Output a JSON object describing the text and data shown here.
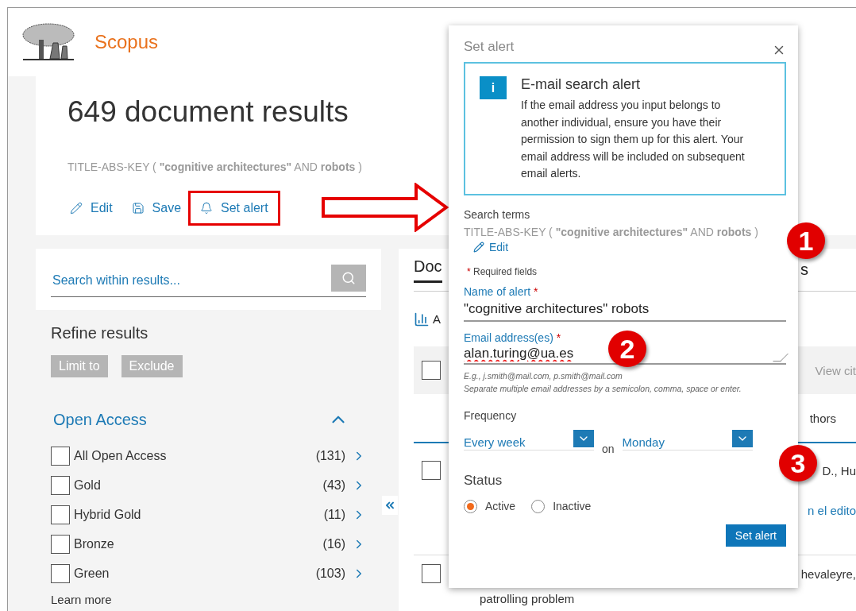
{
  "header": {
    "brand": "Scopus"
  },
  "results": {
    "title": "649 document results",
    "query": "TITLE-ABS-KEY ( **\"cognitive architectures\"**  AND  **robots** )",
    "actions": [
      {
        "kind": "edit",
        "label": "Edit",
        "highlighted": false
      },
      {
        "kind": "save",
        "label": "Save",
        "highlighted": false
      },
      {
        "kind": "alert",
        "label": "Set alert",
        "highlighted": true
      }
    ]
  },
  "search_within": {
    "placeholder": "Search within results..."
  },
  "refine": {
    "title": "Refine results",
    "buttons": [
      "Limit to",
      "Exclude"
    ]
  },
  "open_access": {
    "title": "Open Access",
    "expanded": true,
    "items": [
      {
        "label": "All Open Access",
        "count": "(131)",
        "checked": false
      },
      {
        "label": "Gold",
        "count": "(43)",
        "checked": false
      },
      {
        "label": "Hybrid Gold",
        "count": "(11)",
        "checked": false
      },
      {
        "label": "Bronze",
        "count": "(16)",
        "checked": false
      },
      {
        "label": "Green",
        "count": "(103)",
        "checked": false
      }
    ],
    "learn_more": "Learn more"
  },
  "results_panel": {
    "tab_left": "Doc",
    "tab_right": "s",
    "analyze": "A",
    "select_all_checked": false,
    "view_citations": "View cit",
    "authors": "thors",
    "rows": [
      {
        "kind": "author",
        "text": "D., Hu",
        "checked": false
      },
      {
        "kind": "link",
        "text": "n el edito"
      },
      {
        "kind": "author",
        "text": "hevaleyre,",
        "checked": false
      }
    ],
    "cut_title": "patrolling problem"
  },
  "modal": {
    "title": "Set alert",
    "info": {
      "icon": "i",
      "title": "E-mail search alert",
      "body": "If the email address you input belongs to another individual, ensure you have their permission to sign them up for this alert. Your email address will be included on subsequent email alerts."
    },
    "search_terms_label": "Search terms",
    "query": "TITLE-ABS-KEY ( **\"cognitive architectures\"** AND **robots** )",
    "edit": "Edit",
    "required_mark": "*",
    "required_note": "Required fields",
    "name": {
      "label": "Name of alert",
      "value": "\"cognitive architectures\" robots"
    },
    "email": {
      "label": "Email address(es)",
      "value": "alan.turing@ua.es",
      "hints": [
        "E.g., j.smith@mail.com, p.smith@mail.com",
        "Separate multiple email addresses by a semicolon, comma, space or enter."
      ]
    },
    "frequency": {
      "label": "Frequency",
      "period": "Every week",
      "on": "on",
      "day": "Monday"
    },
    "status": {
      "label": "Status",
      "options": [
        {
          "label": "Active",
          "selected": true
        },
        {
          "label": "Inactive",
          "selected": false
        }
      ]
    },
    "submit": "Set alert"
  },
  "callouts": [
    "1",
    "2",
    "3"
  ]
}
